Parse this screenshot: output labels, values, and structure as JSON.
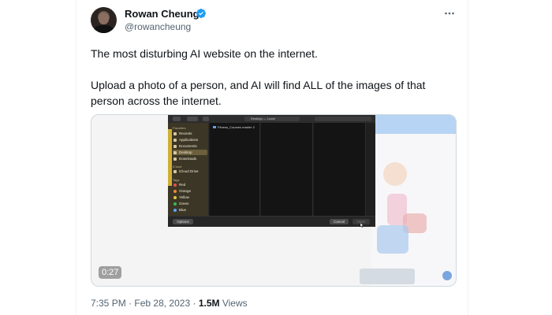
{
  "author": {
    "display_name": "Rowan Cheung",
    "handle": "@rowancheung",
    "verified": true
  },
  "tweet": {
    "paragraphs": [
      "The most disturbing AI website on the internet.",
      "Upload a photo of a person, and AI will find ALL of the images of that person across the internet."
    ]
  },
  "media": {
    "duration": "0:27",
    "dialog": {
      "location": "Desktop — Local",
      "path": "Fitness_Courses master 3",
      "sidebar_sections": {
        "favorites": "Favorites",
        "cloud": "iCloud",
        "tags": "Tags"
      },
      "favorites": [
        "Recents",
        "Applications",
        "Documents",
        "Desktop",
        "Downloads"
      ],
      "cloud": [
        "iCloud Drive"
      ],
      "tags": [
        "Red",
        "Orange",
        "Yellow",
        "Green",
        "Blue"
      ],
      "options_label": "Options",
      "cancel_label": "Cancel",
      "open_label": "Open"
    }
  },
  "meta": {
    "time": "7:35 PM",
    "separator": "·",
    "date": "Feb 28, 2023",
    "views_count": "1.5M",
    "views_label": "Views"
  },
  "colors": {
    "verified_blue": "#1d9bf0",
    "secondary_text": "#536471",
    "primary_text": "#0f1419",
    "tag_red": "#e5534b",
    "tag_orange": "#f0883e",
    "tag_yellow": "#e8c43a",
    "tag_green": "#3fb950",
    "tag_blue": "#58a6ff"
  },
  "icons": {
    "more": "more-horizontal-icon",
    "verified": "verified-badge-icon"
  }
}
